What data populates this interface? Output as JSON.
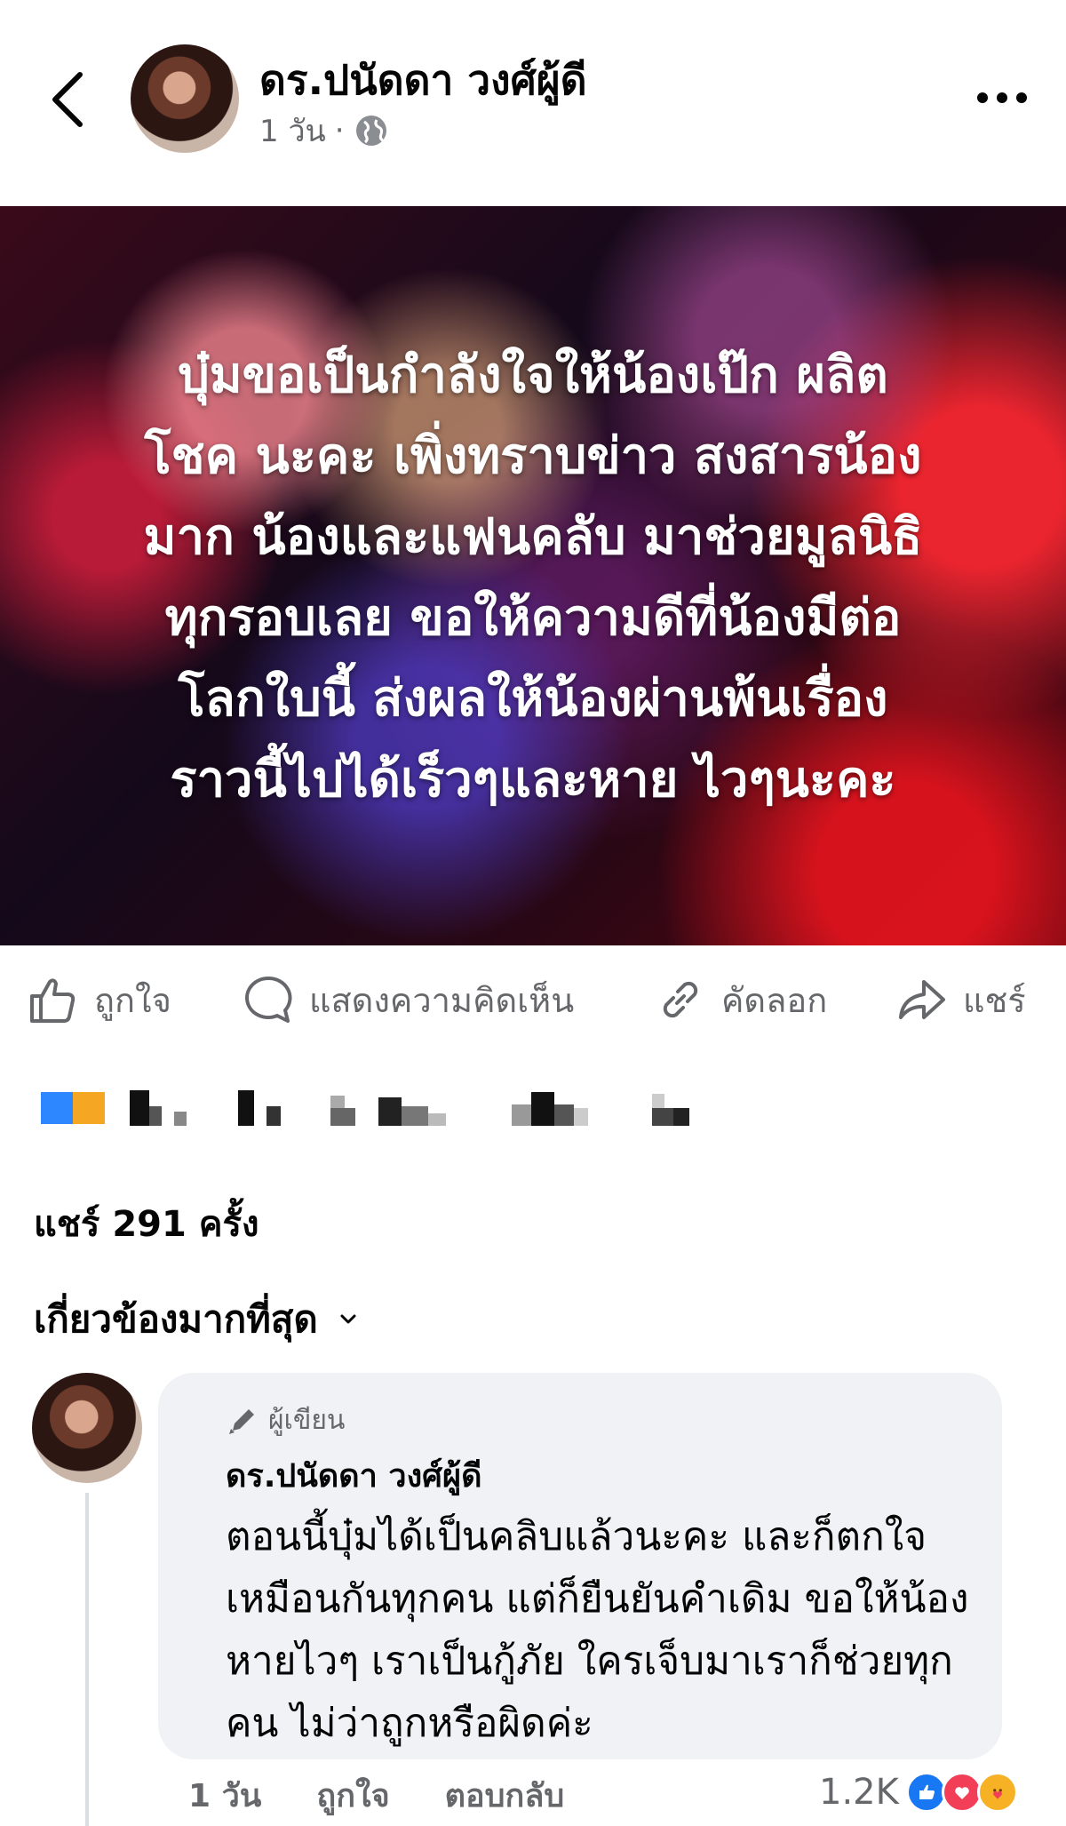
{
  "header": {
    "author_name": "ดร.ปนัดดา วงศ์ผู้ดี",
    "time": "1 วัน",
    "separator": "·"
  },
  "post": {
    "text": "บุ๋มขอเป็นกำลังใจให้น้องเป๊ก ผลิตโชค นะคะ เพิ่งทราบข่าว สงสารน้องมาก น้องและแฟนคลับ มาช่วยมูลนิธิทุกรอบเลย ขอให้ความดีที่น้องมีต่อโลกใบนี้ ส่งผลให้น้องผ่านพ้นเรื่องราวนี้ไปได้เร็วๆและหาย ไวๆนะคะ",
    "lines": [
      "บุ๋มขอเป็นกำลังใจให้น้องเป๊ก ผลิต",
      "โชค นะคะ เพิ่งทราบข่าว สงสารน้อง",
      "มาก น้องและแฟนคลับ มาช่วยมูลนิธิ",
      "ทุกรอบเลย ขอให้ความดีที่น้องมีต่อ",
      "โลกใบนี้ ส่งผลให้น้องผ่านพ้นเรื่อง",
      "ราวนี้ไปได้เร็วๆและหาย ไวๆนะคะ"
    ]
  },
  "actions": {
    "like": "ถูกใจ",
    "comment": "แสดงความคิดเห็น",
    "copy": "คัดลอก",
    "share": "แชร์"
  },
  "stats": {
    "shares": "แชร์ 291 ครั้ง"
  },
  "sort": {
    "label": "เกี่ยวข้องมากที่สุด"
  },
  "comment": {
    "badge": "ผู้เขียน",
    "author": "ดร.ปนัดดา วงศ์ผู้ดี",
    "text": "ตอนนี้บุ๋มได้เป็นคลิบแล้วนะคะ และก็ตกใจเหมือนกันทุกคน แต่ก็ยืนยันคำเดิม ขอให้น้องหายไวๆ เราเป็นกู้ภัย ใครเจ็บมาเราก็ช่วยทุกคน ไม่ว่าถูกหรือผิดค่ะ",
    "time": "1 วัน",
    "like": "ถูกใจ",
    "reply": "ตอบกลับ",
    "reaction_count": "1.2K",
    "reaction_icons": [
      "like-icon",
      "love-icon",
      "care-icon"
    ]
  },
  "colors": {
    "text_secondary": "#65676b",
    "bubble_bg": "#f0f2f5",
    "like_blue": "#1877f2",
    "love_red": "#f33e58",
    "care_yellow": "#f7b125"
  }
}
